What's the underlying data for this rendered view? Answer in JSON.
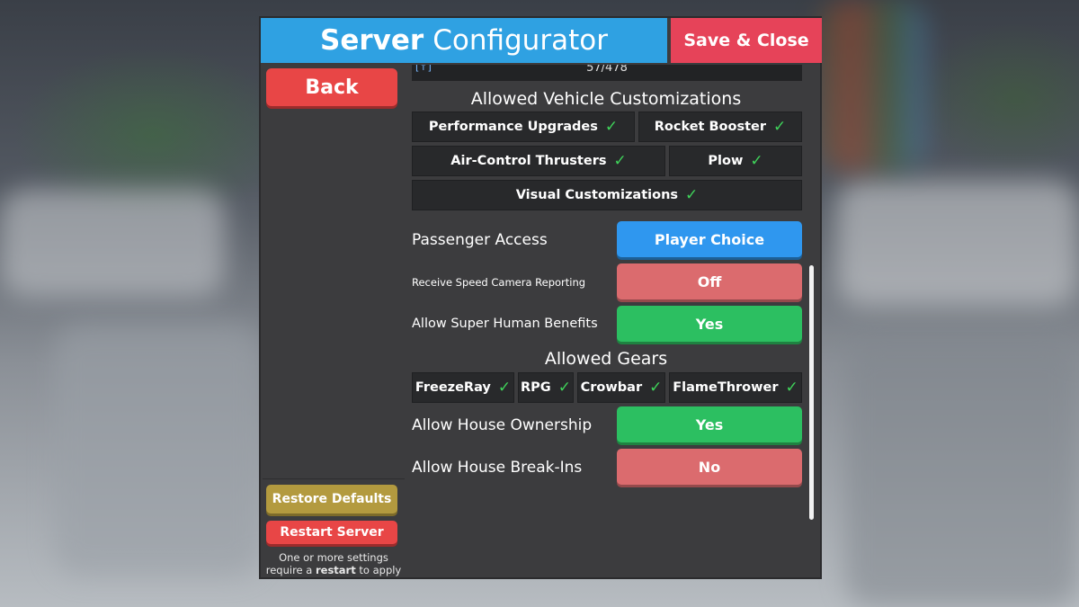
{
  "header": {
    "title_bold": "Server",
    "title_rest": "Configurator",
    "save_close_label": "Save & Close"
  },
  "sidebar": {
    "back_label": "Back",
    "restore_label": "Restore Defaults",
    "restart_label": "Restart Server",
    "note_line1": "One or more settings",
    "note_line2_pre": "require a",
    "note_line2_bold": "restart",
    "note_line2_post": "to apply"
  },
  "progress": {
    "icon": "[↑]",
    "text": "57/478"
  },
  "vehicle_customizations": {
    "title": "Allowed Vehicle Customizations",
    "items": [
      {
        "label": "Performance Upgrades",
        "check": "✓"
      },
      {
        "label": "Rocket Booster",
        "check": "✓"
      },
      {
        "label": "Air-Control Thrusters",
        "check": "✓"
      },
      {
        "label": "Plow",
        "check": "✓"
      },
      {
        "label": "Visual Customizations",
        "check": "✓"
      }
    ]
  },
  "settings": {
    "passenger_access": {
      "label": "Passenger Access",
      "value": "Player Choice"
    },
    "speed_camera": {
      "label": "Receive Speed Camera Reporting",
      "value": "Off"
    },
    "super_human": {
      "label": "Allow Super Human Benefits",
      "value": "Yes"
    },
    "house_ownership": {
      "label": "Allow House Ownership",
      "value": "Yes"
    },
    "house_breakins": {
      "label": "Allow House Break-Ins",
      "value": "No"
    }
  },
  "gears": {
    "title": "Allowed Gears",
    "items": [
      {
        "label": "FreezeRay",
        "check": "✓"
      },
      {
        "label": "RPG",
        "check": "✓"
      },
      {
        "label": "Crowbar",
        "check": "✓"
      },
      {
        "label": "FlameThrower",
        "check": "✓"
      }
    ]
  },
  "colors": {
    "title_bar": "#2fa1e2",
    "save_close": "#e64359",
    "back": "#e84646",
    "restore": "#b39a3f",
    "option_blue": "#2f97ef",
    "option_red": "#db6b6e",
    "option_green": "#2cbf61",
    "check_green": "#3fd35a"
  }
}
